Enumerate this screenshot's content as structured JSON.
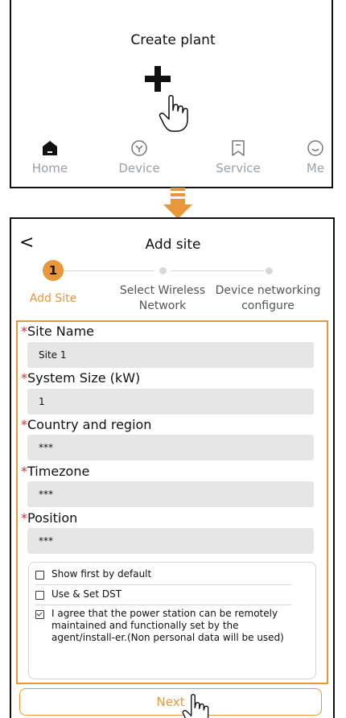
{
  "top": {
    "title": "Create plant",
    "tabs": [
      {
        "label": "Home",
        "icon": "home-icon"
      },
      {
        "label": "Device",
        "icon": "device-icon"
      },
      {
        "label": "Service",
        "icon": "service-icon"
      },
      {
        "label": "Me",
        "icon": "me-icon"
      }
    ]
  },
  "header": {
    "back": "<",
    "title": "Add site"
  },
  "stepper": {
    "step1_number": "1",
    "step1": "Add Site",
    "step2": "Select Wireless Network",
    "step3": "Device networking configure"
  },
  "form": {
    "required_mark": "*",
    "fields": [
      {
        "label": "Site Name",
        "value": "Site 1"
      },
      {
        "label": "System Size (kW)",
        "value": "1"
      },
      {
        "label": "Country and region",
        "value": "***"
      },
      {
        "label": "Timezone",
        "value": "***"
      },
      {
        "label": "Position",
        "value": "***"
      }
    ],
    "options": [
      {
        "label": "Show first by default",
        "checked": false
      },
      {
        "label": "Use & Set DST",
        "checked": false
      },
      {
        "label": "I agree that the power station can be remotely maintained and functionally set by the agent/install-er.(Non personal data will be used)",
        "checked": true
      }
    ]
  },
  "next_label": "Next",
  "colors": {
    "accent": "#E8973A",
    "required": "#d32f2f",
    "input_bg": "#e6e6e6"
  }
}
